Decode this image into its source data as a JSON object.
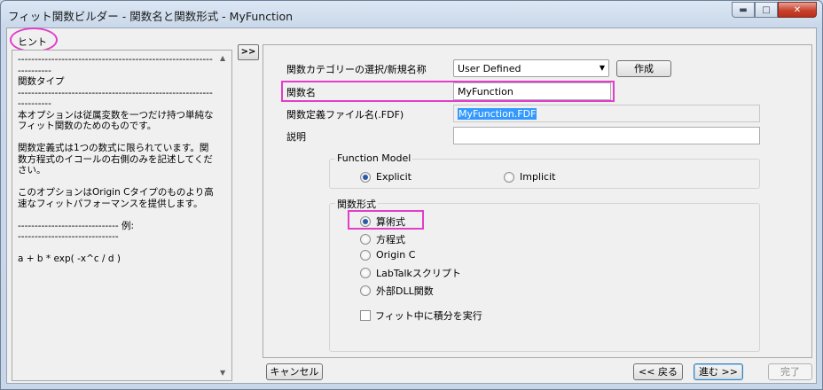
{
  "window": {
    "title": "フィット関数ビルダー - 関数名と関数形式 - MyFunction",
    "minimize_glyph": "▬",
    "maximize_glyph": "□",
    "close_glyph": "✕"
  },
  "hint": {
    "label": "ヒント",
    "text": "--------------------------------------------------------------------\n関数タイプ\n--------------------------------------------------------------------\n本オプションは従属変数を一つだけ持つ単純なフィット関数のためのものです。\n\n関数定義式は1つの数式に限られています。関数方程式のイコールの右側のみを記述してください。\n\nこのオプションはOrigin Cタイプのものより高速なフィットパフォーマンスを提供します。\n\n------------------------------ 例:\n------------------------------\n\na + b * exp( -x^c / d )",
    "scroll_up": "▲",
    "scroll_down": "▼"
  },
  "collapse_button": ">>",
  "form": {
    "category_label": "関数カテゴリーの選択/新規名称",
    "category_value": "User Defined",
    "category_arrow": "▼",
    "create_button": "作成",
    "name_label": "関数名",
    "name_value": "MyFunction",
    "fdf_label": "関数定義ファイル名(.FDF)",
    "fdf_value": "MyFunction.FDF",
    "description_label": "説明",
    "description_value": "",
    "function_model": {
      "title": "Function Model",
      "options": [
        "Explicit",
        "Implicit"
      ],
      "selected": "Explicit"
    },
    "function_form": {
      "title": "関数形式",
      "options": [
        "算術式",
        "方程式",
        "Origin C",
        "LabTalkスクリプト",
        "外部DLL関数"
      ],
      "selected": "算術式"
    },
    "integrate_label": "フィット中に積分を実行",
    "integrate_checked": false
  },
  "footer": {
    "cancel": "キャンセル",
    "back": "<< 戻る",
    "next": "進む >>",
    "finish": "完了"
  },
  "colors": {
    "highlight": "#e23ec8",
    "selection": "#3399ff"
  }
}
